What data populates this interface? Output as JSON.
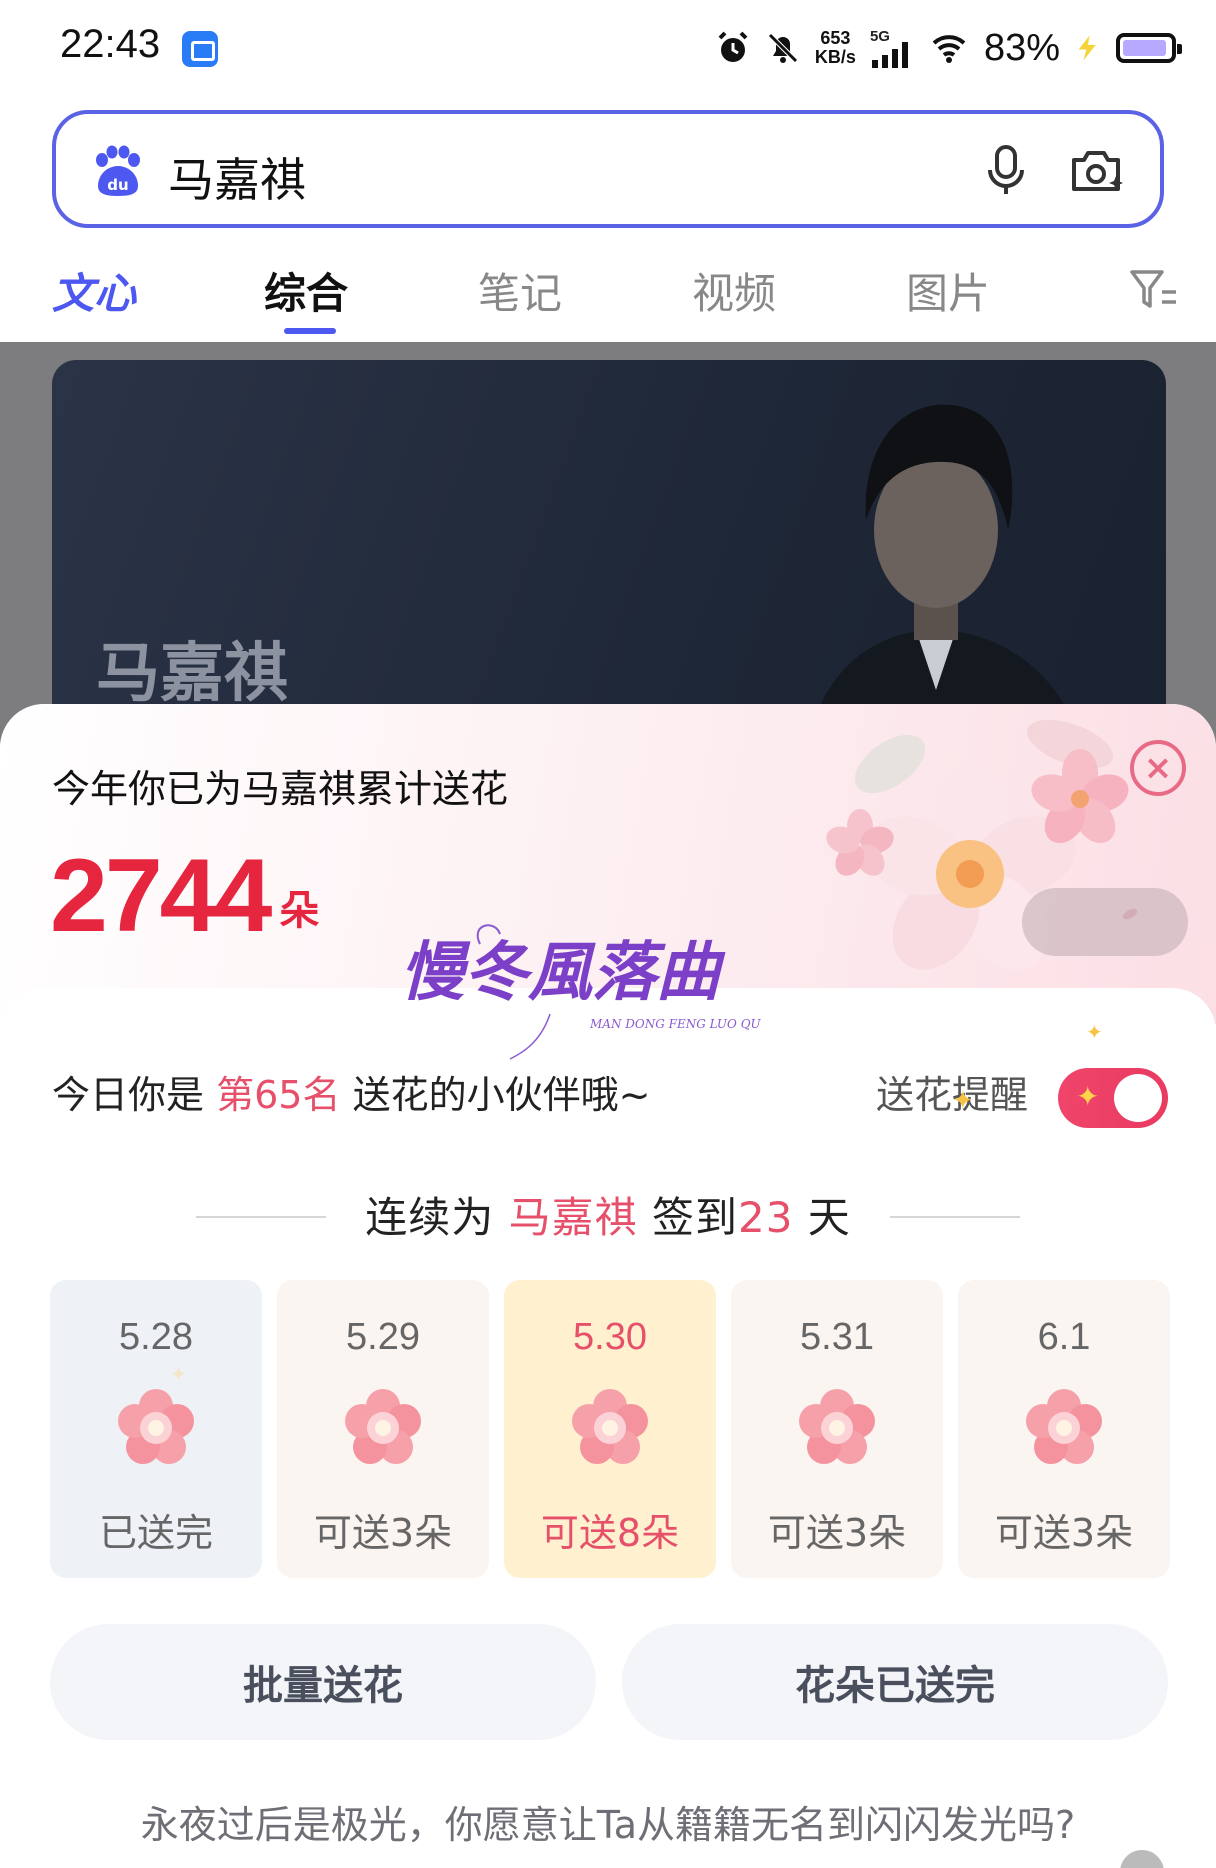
{
  "status_bar": {
    "time": "22:43",
    "net_speed_value": "653",
    "net_speed_unit": "KB/s",
    "network": "5G",
    "battery_percent": "83%",
    "battery_level": 0.83,
    "icons": [
      "alarm-icon",
      "mute-bell-icon",
      "signal-icon",
      "wifi-icon",
      "charging-icon",
      "battery-icon"
    ]
  },
  "search": {
    "query": "马嘉祺",
    "accent_color": "#5a62e6"
  },
  "tabs": {
    "wenxin": "文心",
    "items": [
      "综合",
      "笔记",
      "视频",
      "图片"
    ],
    "active_index": 0
  },
  "hero": {
    "name": "马嘉祺"
  },
  "sheet": {
    "subtitle": "今年你已为马嘉祺累计送花",
    "count": "2744",
    "count_unit": "朵",
    "rank_prefix": "今日你是",
    "rank_value": "第65名",
    "rank_suffix": "送花的小伙伴哦~",
    "remind_label": "送花提醒",
    "remind_enabled": true,
    "streak_prefix": "连续为",
    "streak_name": "马嘉祺",
    "streak_mid": "签到",
    "streak_days": "23",
    "streak_suffix": "天",
    "watermark_text": "慢冬風落曲",
    "watermark_sub": "MAN DONG FENG LUO QU",
    "days": [
      {
        "date": "5.28",
        "label": "已送完",
        "state": "done"
      },
      {
        "date": "5.29",
        "label": "可送3朵",
        "state": "future"
      },
      {
        "date": "5.30",
        "label": "可送8朵",
        "state": "today"
      },
      {
        "date": "5.31",
        "label": "可送3朵",
        "state": "future"
      },
      {
        "date": "6.1",
        "label": "可送3朵",
        "state": "future"
      }
    ],
    "btn_batch": "批量送花",
    "btn_done": "花朵已送完",
    "slogan": "永夜过后是极光，你愿意让Ta从籍籍无名到闪闪发光吗?",
    "highlight_color": "#e6506a",
    "count_color": "#e6263f"
  }
}
